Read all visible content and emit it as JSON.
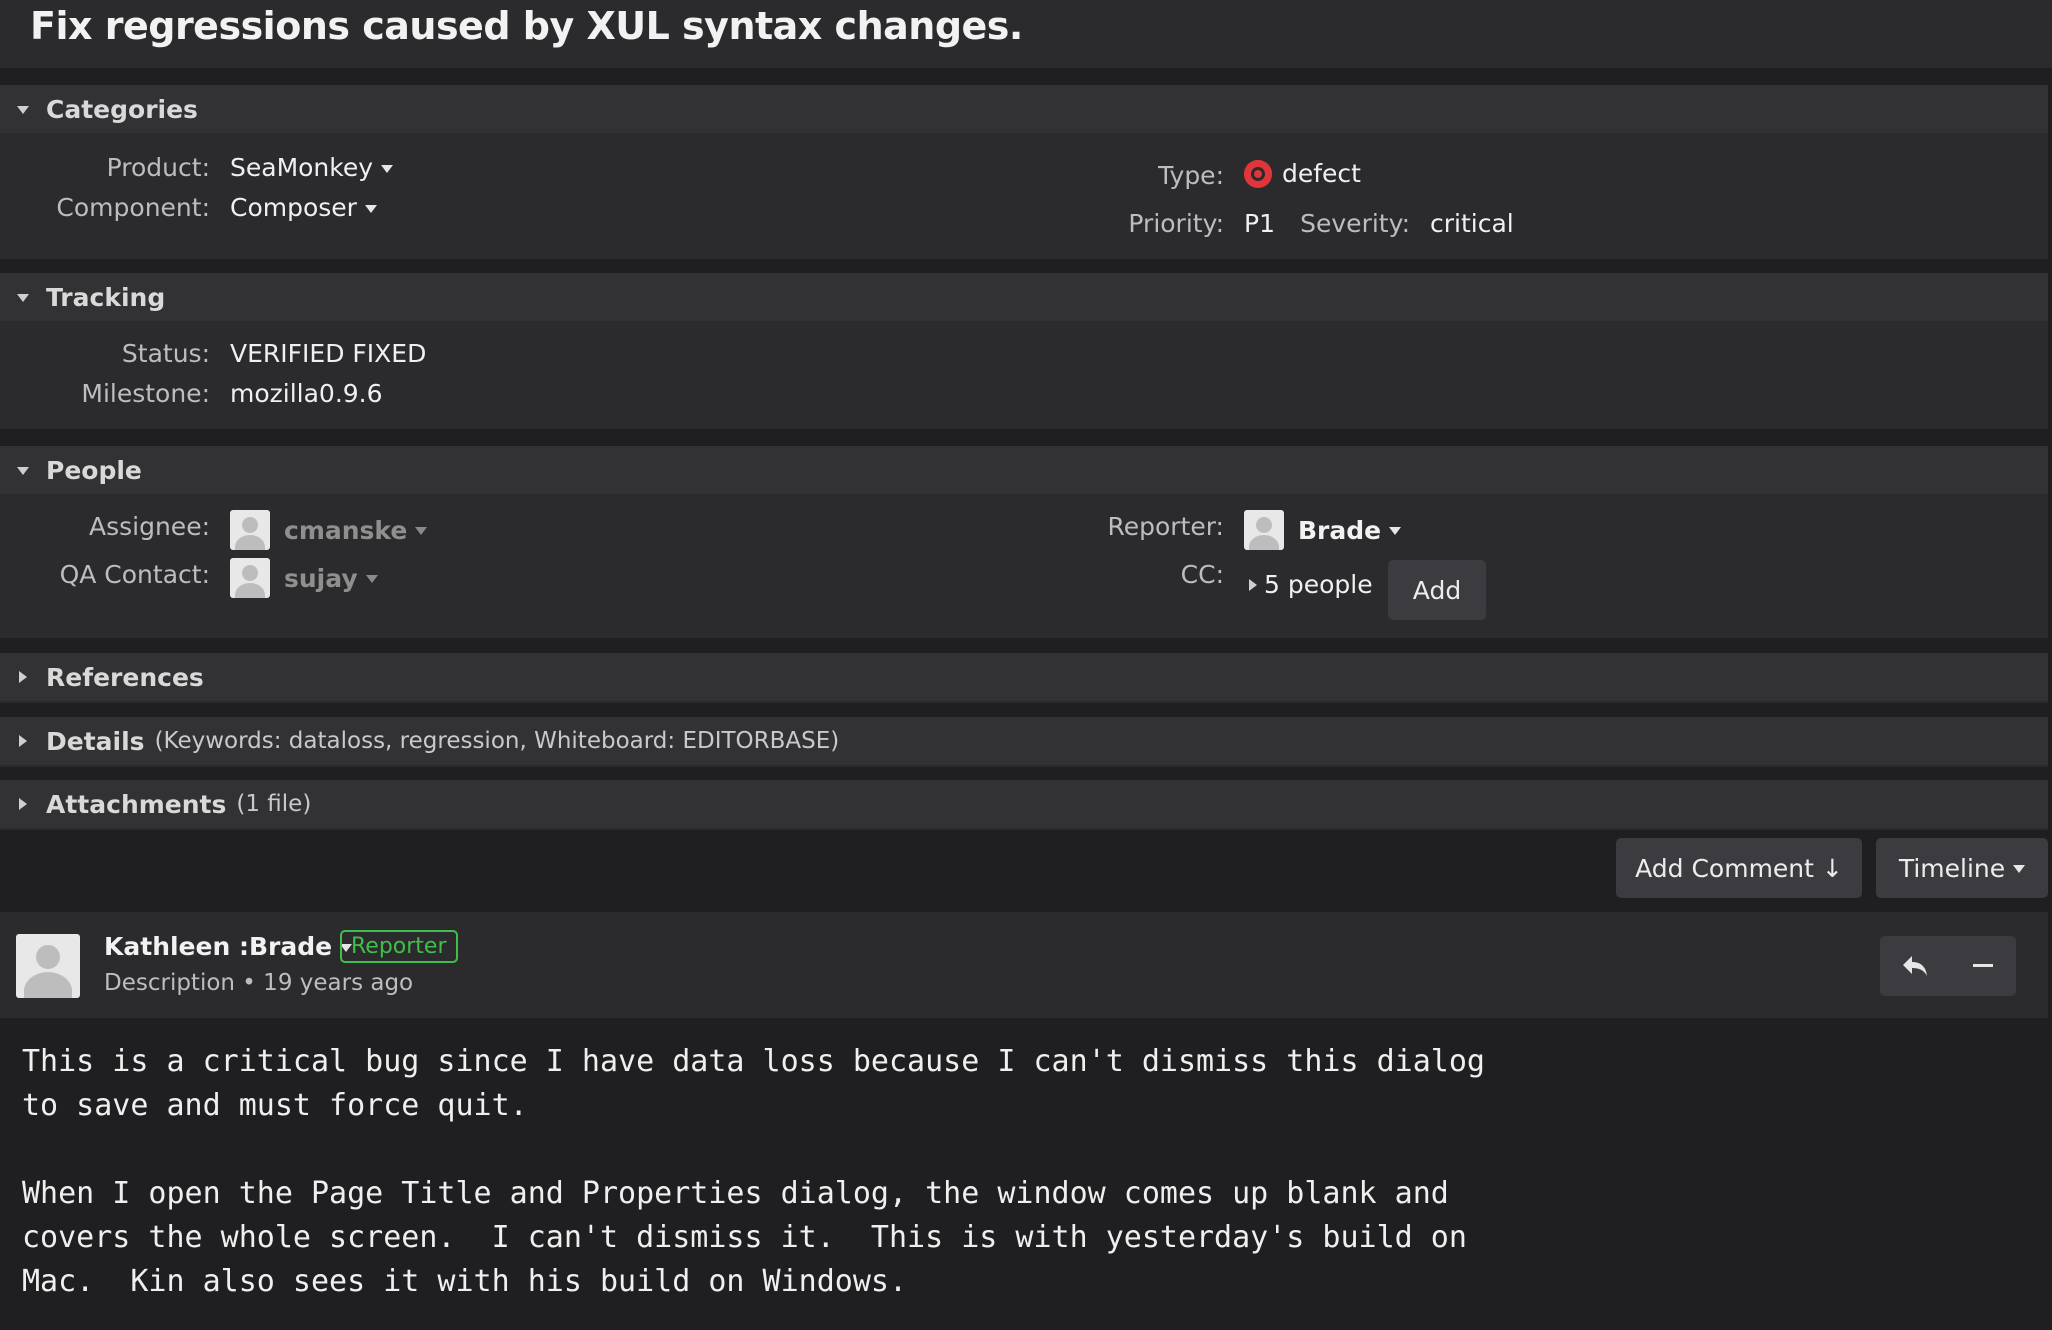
{
  "bug": {
    "title": "Fix regressions caused by XUL syntax changes."
  },
  "categories": {
    "header": "Categories",
    "product_label": "Product:",
    "product_value": "SeaMonkey",
    "component_label": "Component:",
    "component_value": "Composer",
    "type_label": "Type:",
    "type_value": "defect",
    "priority_label": "Priority:",
    "priority_value": "P1",
    "severity_label": "Severity:",
    "severity_value": "critical"
  },
  "tracking": {
    "header": "Tracking",
    "status_label": "Status:",
    "status_value": "VERIFIED FIXED",
    "milestone_label": "Milestone:",
    "milestone_value": "mozilla0.9.6"
  },
  "people": {
    "header": "People",
    "assignee_label": "Assignee:",
    "assignee_value": "cmanske",
    "qa_label": "QA Contact:",
    "qa_value": "sujay",
    "reporter_label": "Reporter:",
    "reporter_value": "Brade",
    "cc_label": "CC:",
    "cc_value": "5 people",
    "add_label": "Add"
  },
  "references": {
    "header": "References"
  },
  "details": {
    "header": "Details",
    "extra": "(Keywords: dataloss, regression, Whiteboard: EDITORBASE)"
  },
  "attachments": {
    "header": "Attachments",
    "extra": "(1 file)"
  },
  "toolbar": {
    "add_comment_label": "Add Comment ↓",
    "timeline_label": "Timeline"
  },
  "comment": {
    "author": "Kathleen :Brade",
    "badge": "Reporter",
    "meta": "Description • 19 years ago",
    "body": "This is a critical bug since I have data loss because I can't dismiss this dialog\nto save and must force quit.\n\nWhen I open the Page Title and Properties dialog, the window comes up blank and\ncovers the whole screen.  I can't dismiss it.  This is with yesterday's build on\nMac.  Kin also sees it with his build on Windows."
  },
  "colors": {
    "background": "#1f1f21",
    "panel": "#2b2b2e",
    "defect": "#e0353b",
    "reporter_badge": "#3fbf4a"
  },
  "icons": [
    "defect-icon",
    "reply-icon",
    "collapse-icon",
    "avatar"
  ]
}
